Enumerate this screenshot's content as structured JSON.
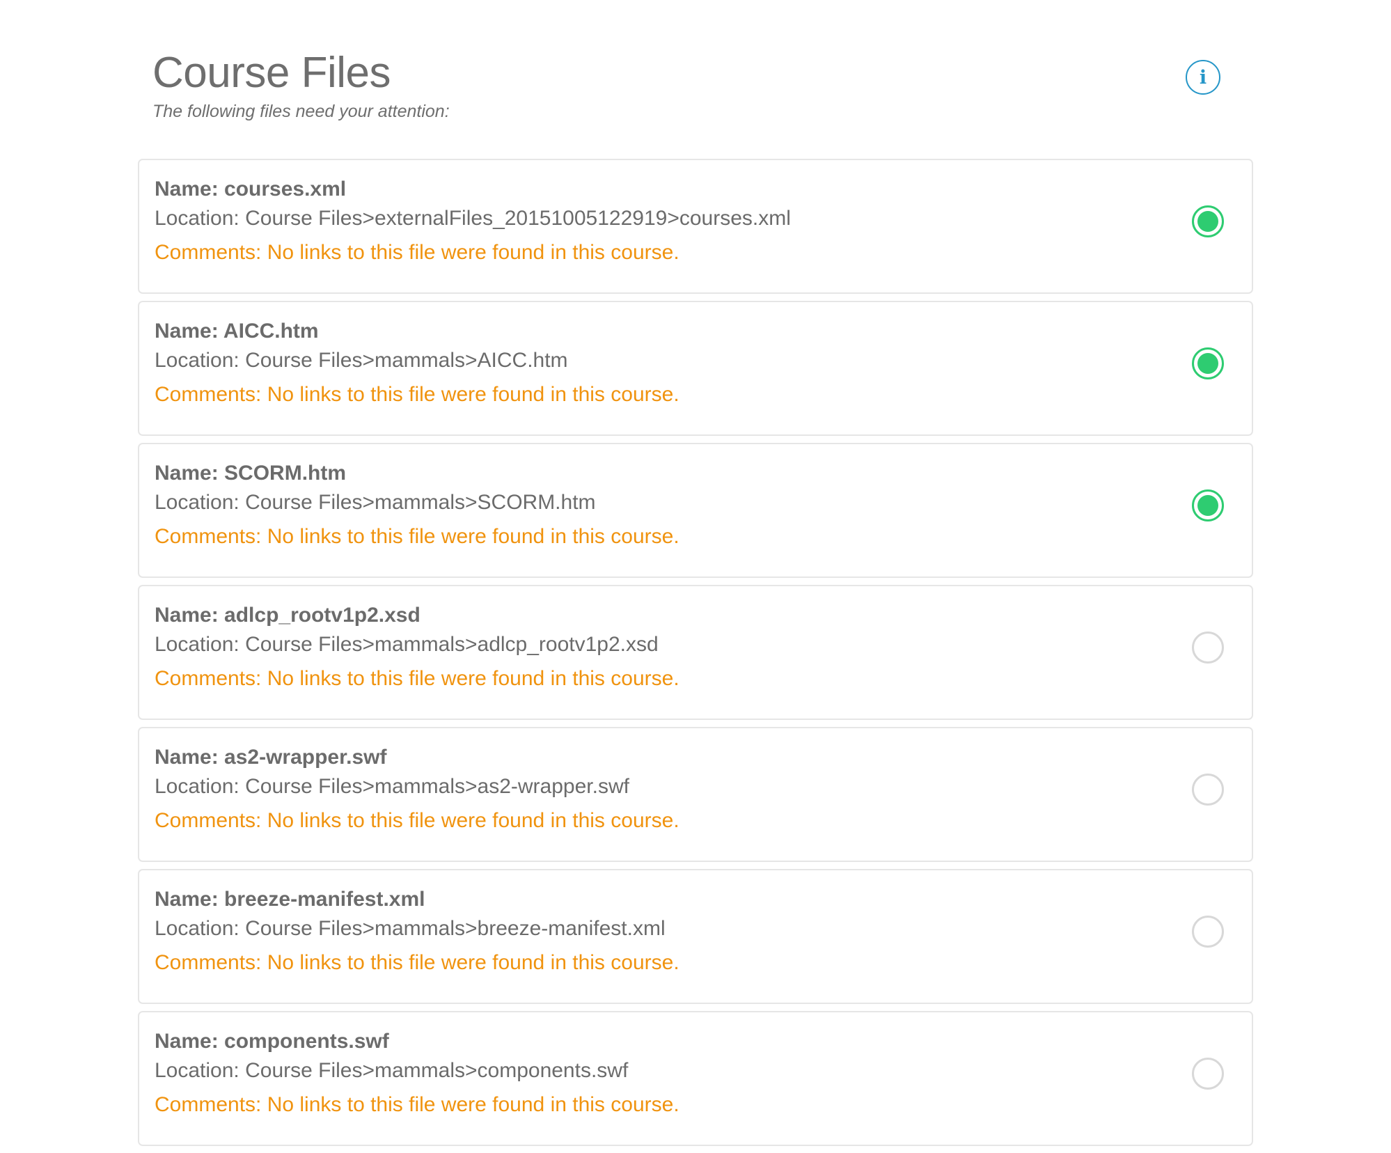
{
  "header": {
    "title": "Course Files",
    "subtitle": "The following files need your attention:",
    "info_icon": "info-icon",
    "info_glyph": "i"
  },
  "colors": {
    "accent_blue": "#2596c8",
    "selected_green": "#2ecc71",
    "comment_orange": "#f0930f",
    "text_gray": "#6b6b6b",
    "border_gray": "#e6e6e6"
  },
  "files": [
    {
      "name": "Name: courses.xml",
      "location": "Location: Course Files>externalFiles_20151005122919>courses.xml",
      "comments": "Comments: No links to this file were found in this course.",
      "selected": true
    },
    {
      "name": "Name: AICC.htm",
      "location": "Location: Course Files>mammals>AICC.htm",
      "comments": "Comments: No links to this file were found in this course.",
      "selected": true
    },
    {
      "name": "Name: SCORM.htm",
      "location": "Location: Course Files>mammals>SCORM.htm",
      "comments": "Comments: No links to this file were found in this course.",
      "selected": true
    },
    {
      "name": "Name: adlcp_rootv1p2.xsd",
      "location": "Location: Course Files>mammals>adlcp_rootv1p2.xsd",
      "comments": "Comments: No links to this file were found in this course.",
      "selected": false
    },
    {
      "name": "Name: as2-wrapper.swf",
      "location": "Location: Course Files>mammals>as2-wrapper.swf",
      "comments": "Comments: No links to this file were found in this course.",
      "selected": false
    },
    {
      "name": "Name: breeze-manifest.xml",
      "location": "Location: Course Files>mammals>breeze-manifest.xml",
      "comments": "Comments: No links to this file were found in this course.",
      "selected": false
    },
    {
      "name": "Name: components.swf",
      "location": "Location: Course Files>mammals>components.swf",
      "comments": "Comments: No links to this file were found in this course.",
      "selected": false
    }
  ]
}
